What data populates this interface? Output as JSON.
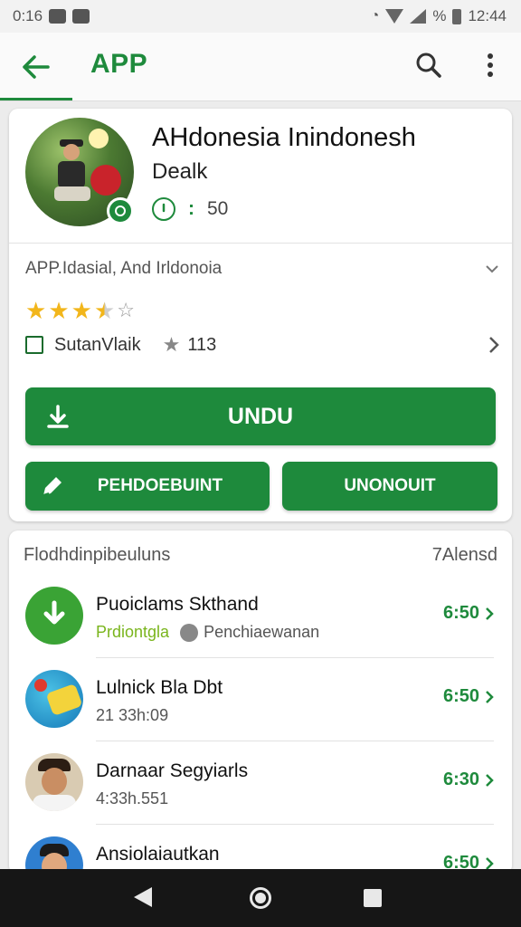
{
  "status_bar": {
    "time_left": "0:16",
    "battery_pct": "%",
    "time_right": "12:44"
  },
  "app_bar": {
    "title": "APP"
  },
  "app": {
    "title": "AHdonesia Inindonesh",
    "subtitle": "Dealk",
    "meta_value": "50",
    "developer": "APP.Idasial, And Irldonoia",
    "rating_stars": 3.5,
    "checkbox_label": "SutanVlaik",
    "review_count": "113",
    "primary_button": "UNDU",
    "secondary_button_left": "PEHDOEBUINT",
    "secondary_button_right": "UNONOUIT"
  },
  "list": {
    "header_left": "Flodhdinpibeuluns",
    "header_right": "7Alensd",
    "items": [
      {
        "name": "Puoiclams Skthand",
        "sub_green": "Prdiontgla",
        "sub_text": "Penchiaewanan",
        "price": "6:50"
      },
      {
        "name": "Lulnick Bla Dbt",
        "sub_text": "21 33h:09",
        "price": "6:50"
      },
      {
        "name": "Darnaar Segyiarls",
        "sub_text": "4:33h.551",
        "price": "6:30"
      },
      {
        "name": "Ansiolaiautkan",
        "sub_text": "",
        "price": "6:50"
      }
    ]
  },
  "colors": {
    "accent": "#1e8a3c",
    "star": "#f2b61b"
  },
  "icons": [
    "back-arrow-icon",
    "search-icon",
    "more-vert-icon",
    "clock-icon",
    "chevron-down-icon",
    "chevron-right-icon",
    "download-icon",
    "edit-icon",
    "star-icon"
  ]
}
